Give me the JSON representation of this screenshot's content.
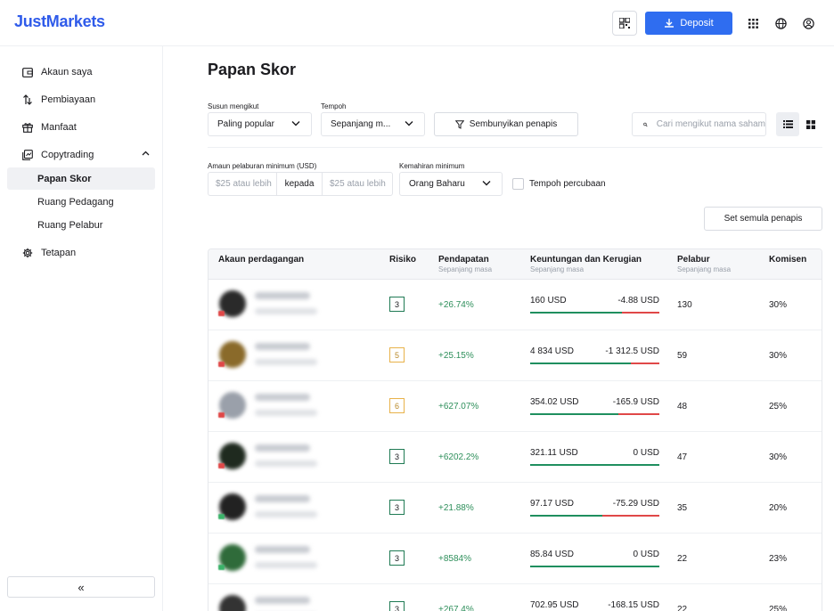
{
  "header": {
    "logo": "JustMarkets",
    "deposit_label": "Deposit"
  },
  "sidebar": {
    "items": [
      {
        "label": "Akaun saya",
        "icon": "wallet-icon"
      },
      {
        "label": "Pembiayaan",
        "icon": "transfer-icon"
      },
      {
        "label": "Manfaat",
        "icon": "gift-icon"
      },
      {
        "label": "Copytrading",
        "icon": "copytrading-icon"
      },
      {
        "label": "Tetapan",
        "icon": "gear-icon"
      }
    ],
    "sub_items": [
      {
        "label": "Papan Skor",
        "active": true
      },
      {
        "label": "Ruang Pedagang",
        "active": false
      },
      {
        "label": "Ruang Pelabur",
        "active": false
      }
    ],
    "collapse_label": "«"
  },
  "page": {
    "title": "Papan Skor"
  },
  "filters": {
    "sort_label": "Susun mengikut",
    "sort_value": "Paling popular",
    "period_label": "Tempoh",
    "period_value": "Sepanjang m...",
    "hide_filters_label": "Sembunyikan penapis",
    "search_placeholder": "Cari mengikut nama saham",
    "min_invest_label": "Amaun pelaburan minimum (USD)",
    "min_placeholder": "$25 atau lebih",
    "to_label": "kepada",
    "max_placeholder": "$25 atau lebih",
    "skill_label": "Kemahiran minimum",
    "skill_value": "Orang Baharu",
    "trial_label": "Tempoh percubaan",
    "reset_label": "Set semula penapis"
  },
  "table": {
    "headers": {
      "account": "Akaun perdagangan",
      "risk": "Risiko",
      "return": "Pendapatan",
      "return_sub": "Sepanjang masa",
      "pl": "Keuntungan dan Kerugian",
      "pl_sub": "Sepanjang masa",
      "investors": "Pelabur",
      "investors_sub": "Sepanjang masa",
      "commission": "Komisen"
    },
    "rows": [
      {
        "risk": "3",
        "risk_level": "low",
        "return": "+26.74%",
        "profit": "160 USD",
        "loss": "-4.88 USD",
        "loss_ratio": 0.29,
        "investors": "130",
        "commission": "30%",
        "avatar_color": "#2a2a2a",
        "badge_color": "#e04848"
      },
      {
        "risk": "5",
        "risk_level": "mid",
        "return": "+25.15%",
        "profit": "4 834 USD",
        "loss": "-1 312.5 USD",
        "loss_ratio": 0.22,
        "investors": "59",
        "commission": "30%",
        "avatar_color": "#8a6a2a",
        "badge_color": "#e04848"
      },
      {
        "risk": "6",
        "risk_level": "mid",
        "return": "+627.07%",
        "profit": "354.02 USD",
        "loss": "-165.9 USD",
        "loss_ratio": 0.32,
        "investors": "48",
        "commission": "25%",
        "avatar_color": "#9aa0aa",
        "badge_color": "#e04848"
      },
      {
        "risk": "3",
        "risk_level": "low",
        "return": "+6202.2%",
        "profit": "321.11 USD",
        "loss": "0 USD",
        "loss_ratio": 0,
        "investors": "47",
        "commission": "30%",
        "avatar_color": "#1f2a1f",
        "badge_color": "#e04848"
      },
      {
        "risk": "3",
        "risk_level": "low",
        "return": "+21.88%",
        "profit": "97.17 USD",
        "loss": "-75.29 USD",
        "loss_ratio": 0.44,
        "investors": "35",
        "commission": "20%",
        "avatar_color": "#222222",
        "badge_color": "#3bb36a"
      },
      {
        "risk": "3",
        "risk_level": "low",
        "return": "+8584%",
        "profit": "85.84 USD",
        "loss": "0 USD",
        "loss_ratio": 0,
        "investors": "22",
        "commission": "23%",
        "avatar_color": "#2f6b3a",
        "badge_color": "#3bb36a"
      },
      {
        "risk": "3",
        "risk_level": "low",
        "return": "+267.4%",
        "profit": "702.95 USD",
        "loss": "-168.15 USD",
        "loss_ratio": 0.19,
        "investors": "22",
        "commission": "25%",
        "avatar_color": "#333333",
        "badge_color": "#3bb36a"
      }
    ]
  },
  "colors": {
    "accent": "#2f6df0",
    "brand": "#2f5bea",
    "positive": "#2e8f5b",
    "negative": "#e04848",
    "risk_low": "#1f7a54",
    "risk_mid": "#e8b24a"
  }
}
